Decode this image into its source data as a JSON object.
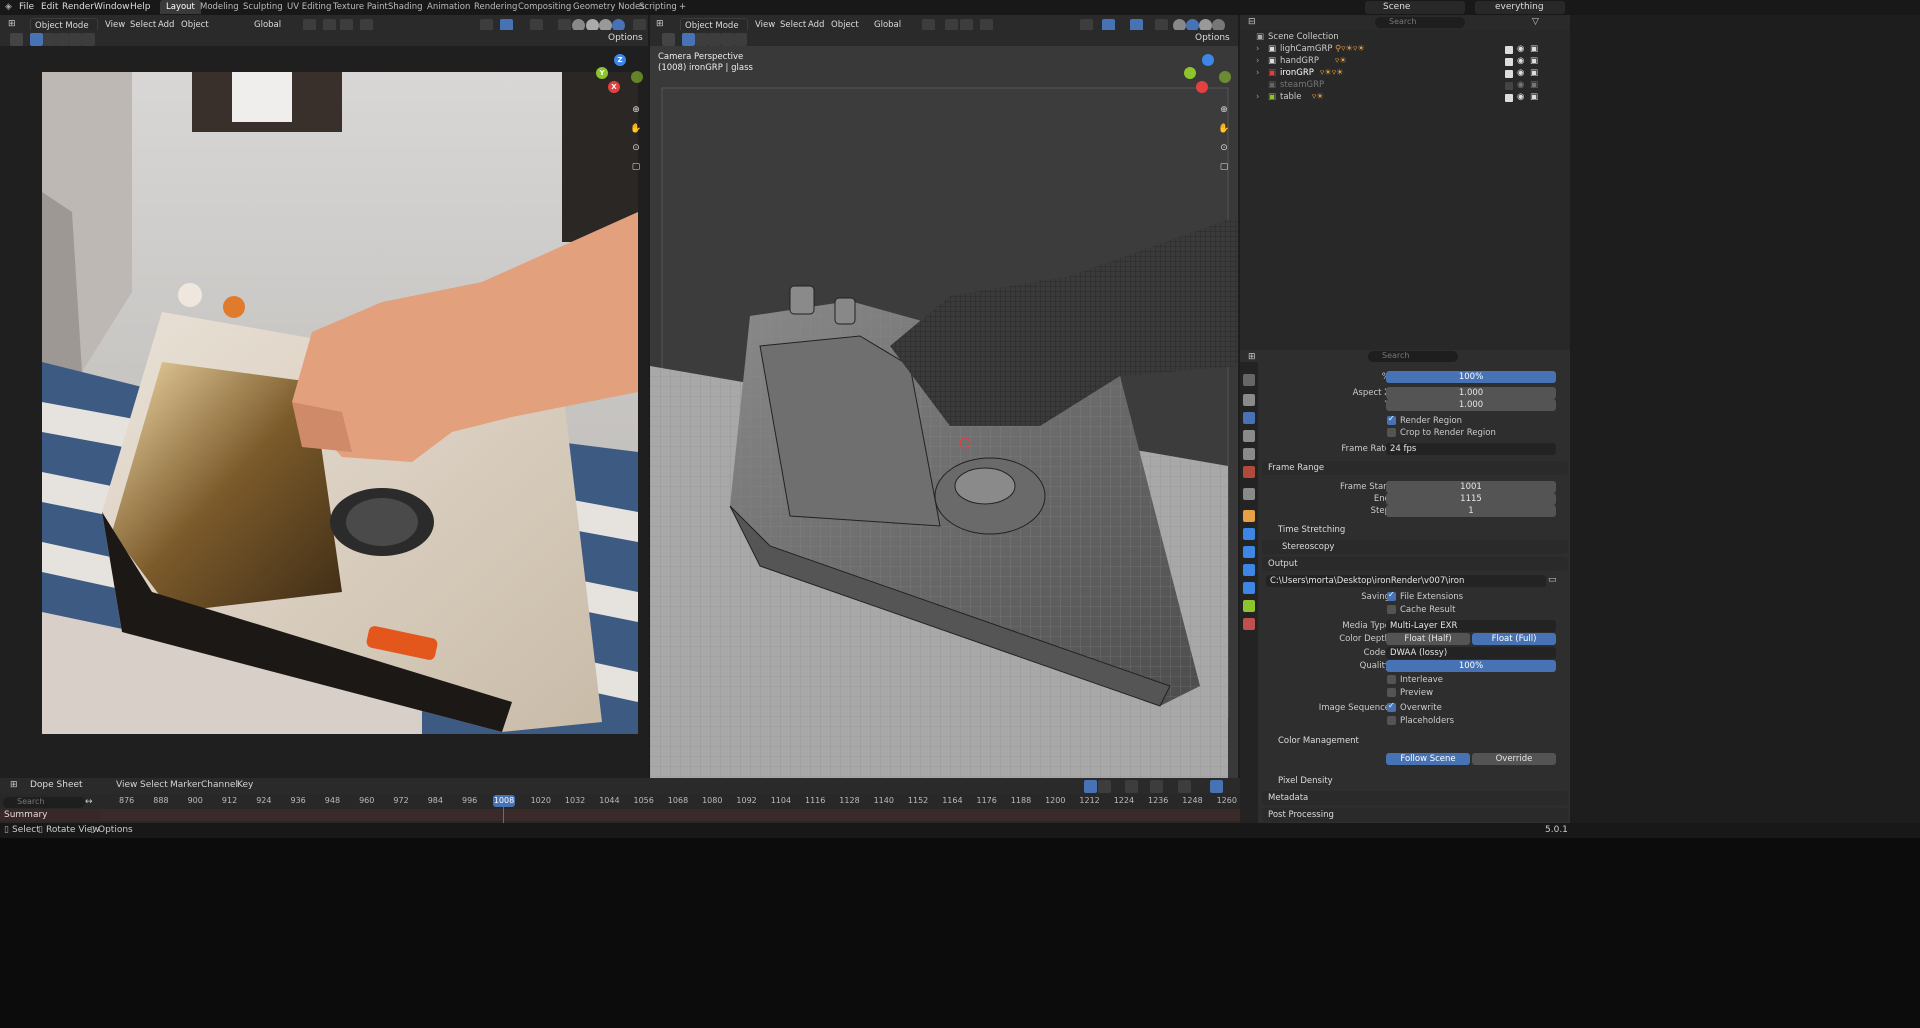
{
  "menu": {
    "file": "File",
    "edit": "Edit",
    "render": "Render",
    "window": "Window",
    "help": "Help"
  },
  "workspaces": [
    "Layout",
    "Modeling",
    "Sculpting",
    "UV Editing",
    "Texture Paint",
    "Shading",
    "Animation",
    "Rendering",
    "Compositing",
    "Geometry Nodes",
    "Scripting"
  ],
  "workspace_add": "+",
  "topbar_right": {
    "scene": "Scene",
    "view_layer": "everything"
  },
  "viewport_left": {
    "mode": "Object Mode",
    "view": "View",
    "select": "Select",
    "add": "Add",
    "object": "Object",
    "orientation": "Global",
    "options": "Options"
  },
  "viewport_right": {
    "mode": "Object Mode",
    "view": "View",
    "select": "Select",
    "add": "Add",
    "object": "Object",
    "orientation": "Global",
    "options": "Options",
    "camera_label": "Camera Perspective",
    "object_label": "(1008) ironGRP | glass"
  },
  "gizmo": {
    "x": "X",
    "y": "Y",
    "z": "Z"
  },
  "outliner": {
    "search_placeholder": "Search",
    "root": "Scene Collection",
    "items": [
      {
        "label": "lighCamGRP",
        "enabled": true
      },
      {
        "label": "handGRP",
        "enabled": true
      },
      {
        "label": "ironGRP",
        "enabled": true
      },
      {
        "label": "steamGRP",
        "enabled": false
      },
      {
        "label": "table",
        "enabled": true
      }
    ]
  },
  "properties": {
    "search_placeholder": "Search",
    "percent_label": "%",
    "percent_value": "100%",
    "aspect_x_label": "Aspect X",
    "aspect_x": "1.000",
    "aspect_y_label": "Y",
    "aspect_y": "1.000",
    "render_region": "Render Region",
    "crop_region": "Crop to Render Region",
    "frame_rate_label": "Frame Rate",
    "frame_rate": "24 fps",
    "frame_range": "Frame Range",
    "frame_start_label": "Frame Start",
    "frame_start": "1001",
    "end_label": "End",
    "end": "1115",
    "step_label": "Step",
    "step": "1",
    "time_stretching": "Time Stretching",
    "stereoscopy": "Stereoscopy",
    "output": "Output",
    "output_path": "C:\\Users\\morta\\Desktop\\ironRender\\v007\\iron",
    "saving_label": "Saving",
    "file_extensions": "File Extensions",
    "cache_result": "Cache Result",
    "media_type_label": "Media Type",
    "media_type": "Multi-Layer EXR",
    "color_depth_label": "Color Depth",
    "depth_half": "Float (Half)",
    "depth_full": "Float (Full)",
    "codec_label": "Codec",
    "codec": "DWAA (lossy)",
    "quality_label": "Quality",
    "quality": "100%",
    "interleave": "Interleave",
    "preview": "Preview",
    "image_sequence_label": "Image Sequence",
    "overwrite": "Overwrite",
    "placeholders": "Placeholders",
    "color_management": "Color Management",
    "follow_scene": "Follow Scene",
    "override": "Override",
    "pixel_density": "Pixel Density",
    "metadata": "Metadata",
    "post_processing": "Post Processing"
  },
  "dopesheet": {
    "editor": "Dope Sheet",
    "view": "View",
    "select": "Select",
    "marker": "Marker",
    "channel": "Channel",
    "key": "Key",
    "search_placeholder": "Search",
    "summary": "Summary",
    "current_frame": "1008",
    "frames": [
      "876",
      "888",
      "900",
      "912",
      "924",
      "936",
      "948",
      "960",
      "972",
      "984",
      "996",
      "1008",
      "1020",
      "1032",
      "1044",
      "1056",
      "1068",
      "1080",
      "1092",
      "1104",
      "1116",
      "1128",
      "1140",
      "1152",
      "1164",
      "1176",
      "1188",
      "1200",
      "1212",
      "1224",
      "1236",
      "1248",
      "1260"
    ]
  },
  "status": {
    "select": "Select",
    "rotate_view": "Rotate View",
    "options": "Options",
    "version": "5.0.1"
  },
  "colors": {
    "accent": "#4772b3",
    "x_axis": "#e2413f",
    "y_axis": "#8ec52d",
    "z_axis": "#3e86e6",
    "frame_marker": "#4772b3"
  }
}
